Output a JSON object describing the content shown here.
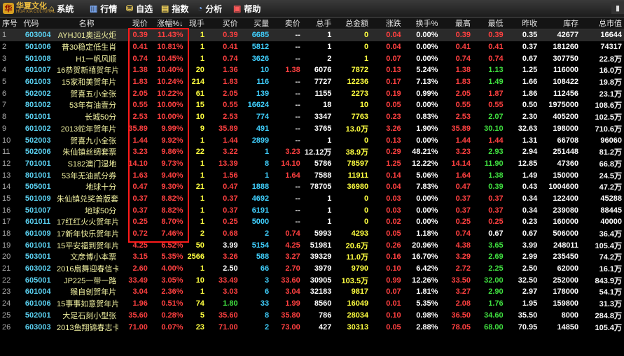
{
  "app": {
    "logo_text": "华夏文化",
    "logo_sub": "HUA XIA CULTURAL",
    "logo_mark": "华"
  },
  "menu": [
    {
      "id": "system",
      "icon": "house-icon",
      "label": "系统"
    },
    {
      "id": "quote",
      "icon": "chart-bars-icon",
      "label": "行情"
    },
    {
      "id": "watchlist",
      "icon": "basket-icon",
      "label": "自选"
    },
    {
      "id": "index",
      "icon": "index-chart-icon",
      "label": "指数"
    },
    {
      "id": "analysis",
      "icon": "pie-icon",
      "label": "分析"
    },
    {
      "id": "help",
      "icon": "help-book-icon",
      "label": "帮助"
    }
  ],
  "columns": [
    "序号",
    "代码",
    "名称",
    "现价",
    "涨幅%↓",
    "现手",
    "买价",
    "买量",
    "卖价",
    "总手",
    "总金额",
    "涨跌",
    "换手%",
    "最高",
    "最低",
    "昨收",
    "库存",
    "总市值"
  ],
  "rows": [
    [
      "1",
      "603004",
      "AYHJ01奥运火炬",
      "0.39",
      "11.43%",
      "1",
      "0.39",
      "6685",
      "--",
      "1",
      "0",
      "0.04",
      "0.00%",
      "0.39",
      "0.39",
      "0.35",
      "42677",
      "16644"
    ],
    [
      "2",
      "501006",
      "普30稳定低生肖",
      "0.41",
      "10.81%",
      "1",
      "0.41",
      "5812",
      "--",
      "1",
      "0",
      "0.04",
      "0.00%",
      "0.41",
      "0.41",
      "0.37",
      "181260",
      "74317"
    ],
    [
      "3",
      "501008",
      "H1一帆风顺",
      "0.74",
      "10.45%",
      "1",
      "0.74",
      "3626",
      "--",
      "2",
      "1",
      "0.07",
      "0.00%",
      "0.74",
      "0.74",
      "0.67",
      "307750",
      "22.8万"
    ],
    [
      "4",
      "601007",
      "16恭贺新禧贺年片",
      "1.38",
      "10.40%",
      "20",
      "1.36",
      "10",
      "1.38",
      "6076",
      "7872",
      "0.13",
      "5.24%",
      "1.38",
      "1.13",
      "1.25",
      "116000",
      "16.0万"
    ],
    [
      "5",
      "601003",
      "15家和美贺年片",
      "1.83",
      "10.24%",
      "214",
      "1.83",
      "116",
      "--",
      "7727",
      "12236",
      "0.17",
      "7.13%",
      "1.83",
      "1.49",
      "1.66",
      "108422",
      "19.8万"
    ],
    [
      "6",
      "502002",
      "贺喜五小全张",
      "2.05",
      "10.22%",
      "61",
      "2.05",
      "139",
      "--",
      "1155",
      "2273",
      "0.19",
      "0.99%",
      "2.05",
      "1.87",
      "1.86",
      "112456",
      "23.1万"
    ],
    [
      "7",
      "801002",
      "53年有油壹分",
      "0.55",
      "10.00%",
      "15",
      "0.55",
      "16624",
      "--",
      "18",
      "10",
      "0.05",
      "0.00%",
      "0.55",
      "0.55",
      "0.50",
      "1975000",
      "108.6万"
    ],
    [
      "8",
      "501001",
      "长城50分",
      "2.53",
      "10.00%",
      "10",
      "2.53",
      "774",
      "--",
      "3347",
      "7763",
      "0.23",
      "0.83%",
      "2.53",
      "2.07",
      "2.30",
      "405200",
      "102.5万"
    ],
    [
      "9",
      "601002",
      "2013蛇年贺年片",
      "35.89",
      "9.99%",
      "9",
      "35.89",
      "491",
      "--",
      "3765",
      "13.0万",
      "3.26",
      "1.90%",
      "35.89",
      "30.10",
      "32.63",
      "198000",
      "710.6万"
    ],
    [
      "10",
      "502003",
      "贺喜九小全张",
      "1.44",
      "9.92%",
      "1",
      "1.44",
      "2899",
      "--",
      "1",
      "0",
      "0.13",
      "0.00%",
      "1.44",
      "1.44",
      "1.31",
      "66708",
      "96060"
    ],
    [
      "11",
      "502006",
      "朱仙镇丝绸套票",
      "3.23",
      "9.86%",
      "22",
      "3.22",
      "1",
      "3.23",
      "12.12万",
      "38.9万",
      "0.29",
      "48.21%",
      "3.23",
      "2.93",
      "2.94",
      "251448",
      "81.2万"
    ],
    [
      "12",
      "701001",
      "S182澳门湿地",
      "14.10",
      "9.73%",
      "1",
      "13.39",
      "8",
      "14.10",
      "5786",
      "78597",
      "1.25",
      "12.22%",
      "14.14",
      "11.90",
      "12.85",
      "47360",
      "66.8万"
    ],
    [
      "13",
      "801001",
      "53年无油贰分券",
      "1.63",
      "9.40%",
      "1",
      "1.56",
      "1",
      "1.64",
      "7588",
      "11911",
      "0.14",
      "5.06%",
      "1.64",
      "1.38",
      "1.49",
      "150000",
      "24.5万"
    ],
    [
      "14",
      "505001",
      "地球十分",
      "0.47",
      "9.30%",
      "21",
      "0.47",
      "1888",
      "--",
      "78705",
      "36980",
      "0.04",
      "7.83%",
      "0.47",
      "0.39",
      "0.43",
      "1004600",
      "47.2万"
    ],
    [
      "15",
      "501009",
      "朱仙镇兑奖普版套",
      "0.37",
      "8.82%",
      "1",
      "0.37",
      "4692",
      "--",
      "1",
      "0",
      "0.03",
      "0.00%",
      "0.37",
      "0.37",
      "0.34",
      "122400",
      "45288"
    ],
    [
      "16",
      "501007",
      "地球50分",
      "0.37",
      "8.82%",
      "1",
      "0.37",
      "6191",
      "--",
      "1",
      "0",
      "0.03",
      "0.00%",
      "0.37",
      "0.37",
      "0.34",
      "239080",
      "88445"
    ],
    [
      "17",
      "601011",
      "17红红火火贺年片",
      "0.25",
      "8.70%",
      "1",
      "0.25",
      "5000",
      "--",
      "1",
      "0",
      "0.02",
      "0.00%",
      "0.25",
      "0.25",
      "0.23",
      "160000",
      "40000"
    ],
    [
      "18",
      "601009",
      "17新年快乐贺年片",
      "0.72",
      "7.46%",
      "2",
      "0.68",
      "2",
      "0.74",
      "5993",
      "4293",
      "0.05",
      "1.18%",
      "0.74",
      "0.67",
      "0.67",
      "506000",
      "36.4万"
    ],
    [
      "19",
      "601001",
      "15平安福到贺年片",
      "4.25",
      "6.52%",
      "50",
      "3.99",
      "5154",
      "4.25",
      "51981",
      "20.6万",
      "0.26",
      "20.96%",
      "4.38",
      "3.65",
      "3.99",
      "248011",
      "105.4万"
    ],
    [
      "20",
      "503001",
      "文彦博小本票",
      "3.15",
      "5.35%",
      "2566",
      "3.26",
      "588",
      "3.27",
      "39329",
      "11.0万",
      "0.16",
      "16.70%",
      "3.29",
      "2.69",
      "2.99",
      "235450",
      "74.2万"
    ],
    [
      "21",
      "603002",
      "2016扇舞迎春信卡",
      "2.60",
      "4.00%",
      "1",
      "2.50",
      "66",
      "2.70",
      "3979",
      "9790",
      "0.10",
      "6.42%",
      "2.72",
      "2.25",
      "2.50",
      "62000",
      "16.1万"
    ],
    [
      "22",
      "605001",
      "JP225一带一路",
      "33.49",
      "3.05%",
      "10",
      "33.49",
      "3",
      "33.60",
      "30905",
      "103.5万",
      "0.99",
      "12.26%",
      "33.50",
      "32.00",
      "32.50",
      "252000",
      "843.9万"
    ],
    [
      "23",
      "601004",
      "猴自创贺年片",
      "3.04",
      "2.36%",
      "1",
      "3.03",
      "6",
      "3.04",
      "32183",
      "9817",
      "0.07",
      "1.81%",
      "3.27",
      "2.90",
      "2.97",
      "178000",
      "54.1万"
    ],
    [
      "24",
      "601006",
      "15事事如意贺年片",
      "1.96",
      "0.51%",
      "74",
      "1.80",
      "33",
      "1.99",
      "8560",
      "16049",
      "0.01",
      "5.35%",
      "2.08",
      "1.76",
      "1.95",
      "159800",
      "31.3万"
    ],
    [
      "25",
      "502001",
      "大足石刻小型张",
      "35.60",
      "0.28%",
      "5",
      "35.60",
      "8",
      "35.80",
      "786",
      "28034",
      "0.10",
      "0.98%",
      "36.50",
      "34.60",
      "35.50",
      "8000",
      "284.8万"
    ],
    [
      "26",
      "603003",
      "2013鱼翔锦春志卡",
      "71.00",
      "0.07%",
      "23",
      "71.00",
      "2",
      "73.00",
      "427",
      "30313",
      "0.05",
      "2.88%",
      "78.05",
      "68.00",
      "70.95",
      "14850",
      "105.4万"
    ]
  ]
}
